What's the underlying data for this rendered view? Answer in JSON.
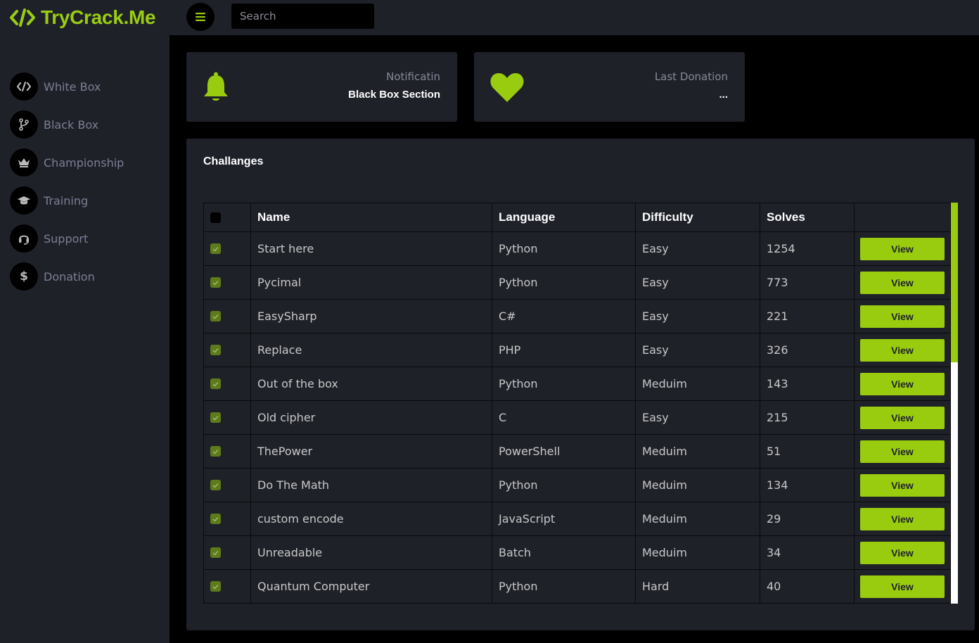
{
  "app": {
    "logo_text": "TryCrack.Me"
  },
  "search": {
    "placeholder": "Search"
  },
  "sidebar": {
    "items": [
      {
        "label": "White Box",
        "icon": "code-icon"
      },
      {
        "label": "Black Box",
        "icon": "branch-icon"
      },
      {
        "label": "Championship",
        "icon": "crown-icon"
      },
      {
        "label": "Training",
        "icon": "graduation-cap-icon"
      },
      {
        "label": "Support",
        "icon": "headset-icon"
      },
      {
        "label": "Donation",
        "icon": "dollar-icon"
      }
    ]
  },
  "cards": {
    "notification": {
      "title": "Notificatin",
      "value": "Black Box Section",
      "icon": "bell-icon"
    },
    "donation": {
      "title": "Last Donation",
      "value": "...",
      "icon": "heart-icon"
    }
  },
  "table": {
    "title": "Challanges",
    "columns": [
      "Name",
      "Language",
      "Difficulty",
      "Solves"
    ],
    "view_label": "View",
    "rows": [
      {
        "name": "Start here",
        "language": "Python",
        "difficulty": "Easy",
        "solves": "1254"
      },
      {
        "name": "Pycimal",
        "language": "Python",
        "difficulty": "Easy",
        "solves": "773"
      },
      {
        "name": "EasySharp",
        "language": "C#",
        "difficulty": "Easy",
        "solves": "221"
      },
      {
        "name": "Replace",
        "language": "PHP",
        "difficulty": "Easy",
        "solves": "326"
      },
      {
        "name": "Out of the box",
        "language": "Python",
        "difficulty": "Meduim",
        "solves": "143"
      },
      {
        "name": "Old cipher",
        "language": "C",
        "difficulty": "Easy",
        "solves": "215"
      },
      {
        "name": "ThePower",
        "language": "PowerShell",
        "difficulty": "Meduim",
        "solves": "51"
      },
      {
        "name": "Do The Math",
        "language": "Python",
        "difficulty": "Meduim",
        "solves": "134"
      },
      {
        "name": "custom encode",
        "language": "JavaScript",
        "difficulty": "Meduim",
        "solves": "29"
      },
      {
        "name": "Unreadable",
        "language": "Batch",
        "difficulty": "Meduim",
        "solves": "34"
      },
      {
        "name": "Quantum Computer",
        "language": "Python",
        "difficulty": "Hard",
        "solves": "40"
      }
    ]
  },
  "colors": {
    "accent": "#99cc0f",
    "panel": "#1f2129",
    "background": "#000000",
    "nav_text": "#7c7f95"
  }
}
